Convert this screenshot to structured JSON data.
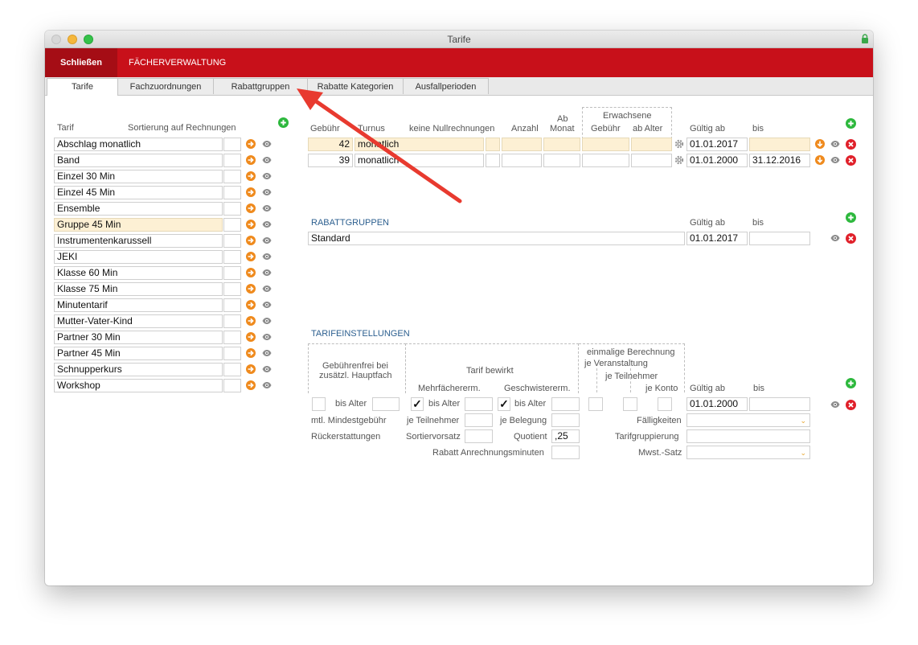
{
  "window": {
    "title": "Tarife"
  },
  "menubar": {
    "close_label": "Schließen",
    "section_label": "FÄCHERVERWALTUNG"
  },
  "tabs": [
    "Tarife",
    "Fachzuordnungen",
    "Rabattgruppen",
    "Rabatte Kategorien",
    "Ausfallperioden"
  ],
  "colors": {
    "brand_red": "#c8101a",
    "highlight": "#fdf0d4",
    "add_green": "#2db83d",
    "delete_red": "#e0202a",
    "arrow_orange": "#ef8a1d"
  },
  "tarif_list": {
    "header_tarif": "Tarif",
    "header_sort": "Sortierung auf Rechnungen",
    "items": [
      "Abschlag monatlich",
      "Band",
      "Einzel 30 Min",
      "Einzel 45 Min",
      "Ensemble",
      "Gruppe 45 Min",
      "Instrumentenkarussell",
      "JEKI",
      "Klasse 60 Min",
      "Klasse 75 Min",
      "Minutentarif",
      "Mutter-Vater-Kind",
      "Partner 30 Min",
      "Partner 45 Min",
      "Schnupperkurs",
      "Workshop"
    ],
    "selected": "Gruppe 45 Min"
  },
  "fees": {
    "headers": {
      "gebuehr": "Gebühr",
      "turnus": "Turnus",
      "keine_null": "keine Nullrechnungen",
      "anzahl": "Anzahl",
      "ab": "Ab",
      "monat": "Monat",
      "erwachsene": "Erwachsene",
      "erw_gebuehr": "Gebühr",
      "erw_ab_alter": "ab Alter",
      "gueltig_ab": "Gültig ab",
      "bis": "bis"
    },
    "rows": [
      {
        "gebuehr": "42",
        "turnus": "monatlich",
        "gueltig_ab": "01.01.2017",
        "bis": ""
      },
      {
        "gebuehr": "39",
        "turnus": "monatlich",
        "gueltig_ab": "01.01.2000",
        "bis": "31.12.2016"
      }
    ]
  },
  "rabattgruppen": {
    "title": "RABATTGRUPPEN",
    "gueltig_ab_header": "Gültig ab",
    "bis_header": "bis",
    "row": {
      "name": "Standard",
      "gueltig_ab": "01.01.2017",
      "bis": ""
    }
  },
  "settings": {
    "title": "TARIFEINSTELLUNGEN",
    "gebuehrenfrei": "Gebührenfrei bei",
    "zusaetzl": "zusätzl. Hauptfach",
    "tarif_bewirkt": "Tarif bewirkt",
    "mehrfacher": "Mehrfächererm.",
    "geschwister": "Geschwistererm.",
    "einmalige": "einmalige Berechnung",
    "je_veranstaltung": "je Veranstaltung",
    "je_teilnehmer_top": "je Teilnehmer",
    "je_konto": "je Konto",
    "gueltig_ab": "Gültig ab",
    "bis": "bis",
    "bis_alter": "bis Alter",
    "check_mark": "✓",
    "gueltig_ab_value": "01.01.2000",
    "mtl_mindest": "mtl. Mindestgebühr",
    "je_teilnehmer": "je Teilnehmer",
    "je_belegung": "je Belegung",
    "faelligkeiten": "Fälligkeiten",
    "rueckerstattungen": "Rückerstattungen",
    "sortiervorsatz": "Sortiervorsatz",
    "quotient": "Quotient",
    "quotient_value": ",25",
    "tarifgruppierung": "Tarifgruppierung",
    "rabatt_anrechnung": "Rabatt Anrechnungsminuten",
    "mwst": "Mwst.-Satz"
  }
}
